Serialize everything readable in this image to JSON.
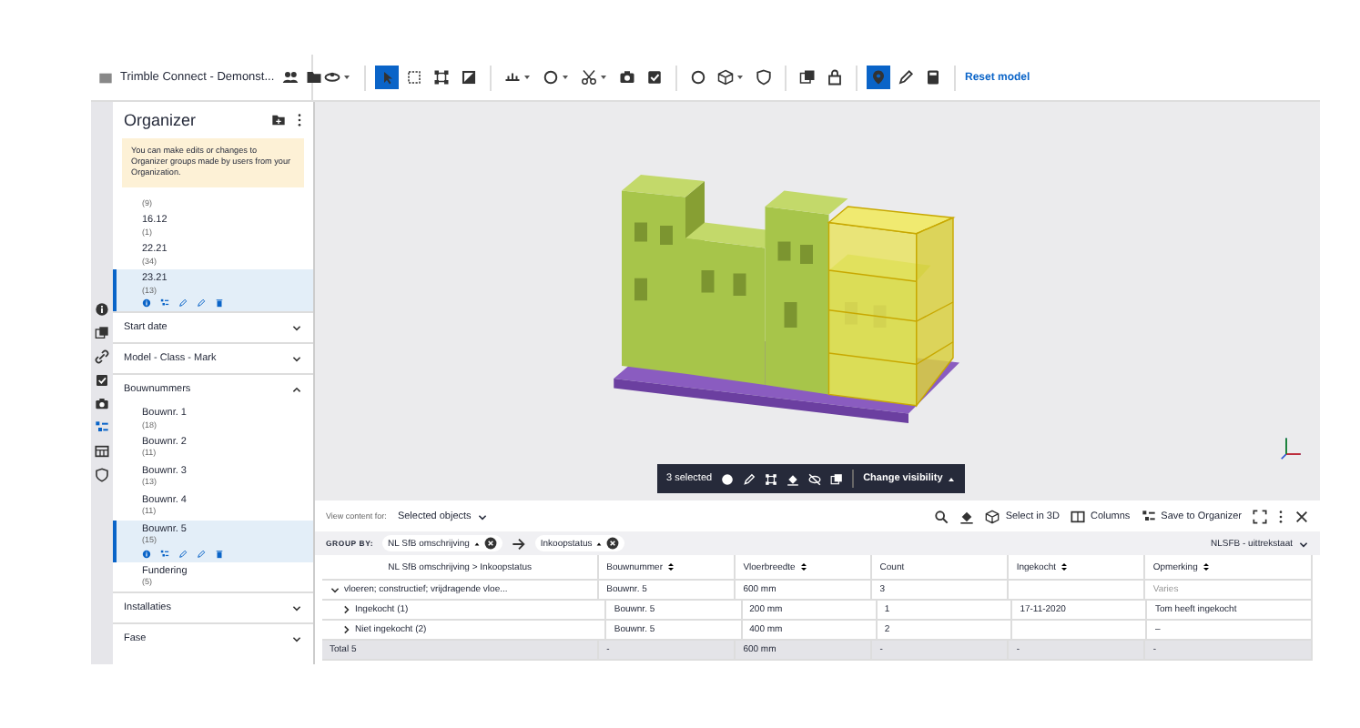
{
  "toolbar": {
    "app_title": "Trimble Connect - Demonst...",
    "tools": [
      {
        "kind": "orbit",
        "dropdown": true,
        "selected": false
      },
      {
        "kind": "pointer",
        "dropdown": false,
        "selected": true
      },
      {
        "kind": "box-select",
        "dropdown": false,
        "selected": false
      },
      {
        "kind": "frame",
        "dropdown": false,
        "selected": false
      },
      {
        "kind": "square-split",
        "dropdown": false,
        "selected": false
      },
      {
        "kind": "measure",
        "dropdown": true,
        "selected": false
      },
      {
        "kind": "circle",
        "dropdown": true,
        "selected": false
      },
      {
        "kind": "scissors",
        "dropdown": true,
        "selected": false
      },
      {
        "kind": "camera",
        "dropdown": false,
        "selected": false
      },
      {
        "kind": "check-square",
        "dropdown": false,
        "selected": false
      },
      {
        "kind": "circle",
        "dropdown": false,
        "selected": false
      },
      {
        "kind": "cube",
        "dropdown": true,
        "selected": false
      },
      {
        "kind": "shield",
        "dropdown": false,
        "selected": false
      },
      {
        "kind": "layers",
        "dropdown": false,
        "selected": false
      },
      {
        "kind": "bag",
        "dropdown": false,
        "selected": false
      },
      {
        "kind": "pin",
        "dropdown": false,
        "selected": true
      },
      {
        "kind": "pencil",
        "dropdown": false,
        "selected": false
      },
      {
        "kind": "calculator",
        "dropdown": false,
        "selected": false
      }
    ],
    "reset_link": "Reset model"
  },
  "rail": [
    {
      "kind": "info",
      "selected": false
    },
    {
      "kind": "layers",
      "selected": false
    },
    {
      "kind": "link",
      "selected": false
    },
    {
      "kind": "check",
      "selected": false
    },
    {
      "kind": "camera",
      "selected": false
    },
    {
      "kind": "tree",
      "selected": true
    },
    {
      "kind": "table",
      "selected": false
    },
    {
      "kind": "shield",
      "selected": false
    }
  ],
  "sidebar": {
    "title": "Organizer",
    "notice": "You can make edits or changes to Organizer groups made by users from your Organization.",
    "top_items": [
      {
        "count": "(9)",
        "selected": false
      },
      {
        "label": "16.12",
        "count": "(1)",
        "selected": false
      },
      {
        "label": "22.21",
        "count": "(34)",
        "selected": false
      },
      {
        "label": "23.21",
        "count": "(13)",
        "selected": true
      }
    ],
    "sections": [
      {
        "title": "Start date",
        "expanded": false
      },
      {
        "title": "Model - Class - Mark",
        "expanded": false
      },
      {
        "title": "Bouwnummers",
        "expanded": true,
        "items": [
          {
            "label": "Bouwnr. 1",
            "count": "(18)",
            "selected": false
          },
          {
            "label": "Bouwnr. 2",
            "count": "(11)",
            "selected": false
          },
          {
            "label": "Bouwnr. 3",
            "count": "(13)",
            "selected": false
          },
          {
            "label": "Bouwnr. 4",
            "count": "(11)",
            "selected": false
          },
          {
            "label": "Bouwnr. 5",
            "count": "(15)",
            "selected": true
          },
          {
            "label": "Fundering",
            "count": "(5)",
            "selected": false
          }
        ]
      },
      {
        "title": "Installaties",
        "expanded": false
      },
      {
        "title": "Fase",
        "expanded": false
      }
    ]
  },
  "viewport": {
    "selection_count": "3 selected",
    "visibility_button": "Change visibility"
  },
  "panel": {
    "view_label": "View content for:",
    "view_value": "Selected objects",
    "select_3d": "Select in 3D",
    "columns": "Columns",
    "save": "Save to Organizer",
    "group_by_label": "GROUP BY:",
    "group_chips": [
      "NL SfB omschrijving",
      "Inkoopstatus"
    ],
    "template": "NLSFB - uittrekstaat",
    "table": {
      "columns": [
        {
          "title": "NL SfB omschrijving > Inkoopstatus",
          "sortable": false
        },
        {
          "title": "Bouwnummer",
          "sortable": true
        },
        {
          "title": "Vloerbreedte",
          "sortable": true
        },
        {
          "title": "Count",
          "sortable": false
        },
        {
          "title": "Ingekocht",
          "sortable": true
        },
        {
          "title": "Opmerking",
          "sortable": true
        }
      ],
      "rows": [
        {
          "expanded": true,
          "cells": [
            "vloeren; constructief; vrijdragende vloe...",
            "Bouwnr. 5",
            "600 mm",
            "3",
            null,
            "Varies"
          ],
          "children": [
            {
              "expanded": false,
              "cells": [
                "Ingekocht (1)",
                "Bouwnr. 5",
                "200 mm",
                "1",
                "17-11-2020",
                "Tom heeft ingekocht"
              ]
            },
            {
              "expanded": false,
              "cells": [
                "Niet ingekocht (2)",
                "Bouwnr. 5",
                "400 mm",
                "2",
                null,
                "–"
              ]
            }
          ]
        }
      ],
      "total": [
        "Total 5",
        "-",
        "600 mm",
        "-",
        "-",
        "-"
      ]
    }
  }
}
